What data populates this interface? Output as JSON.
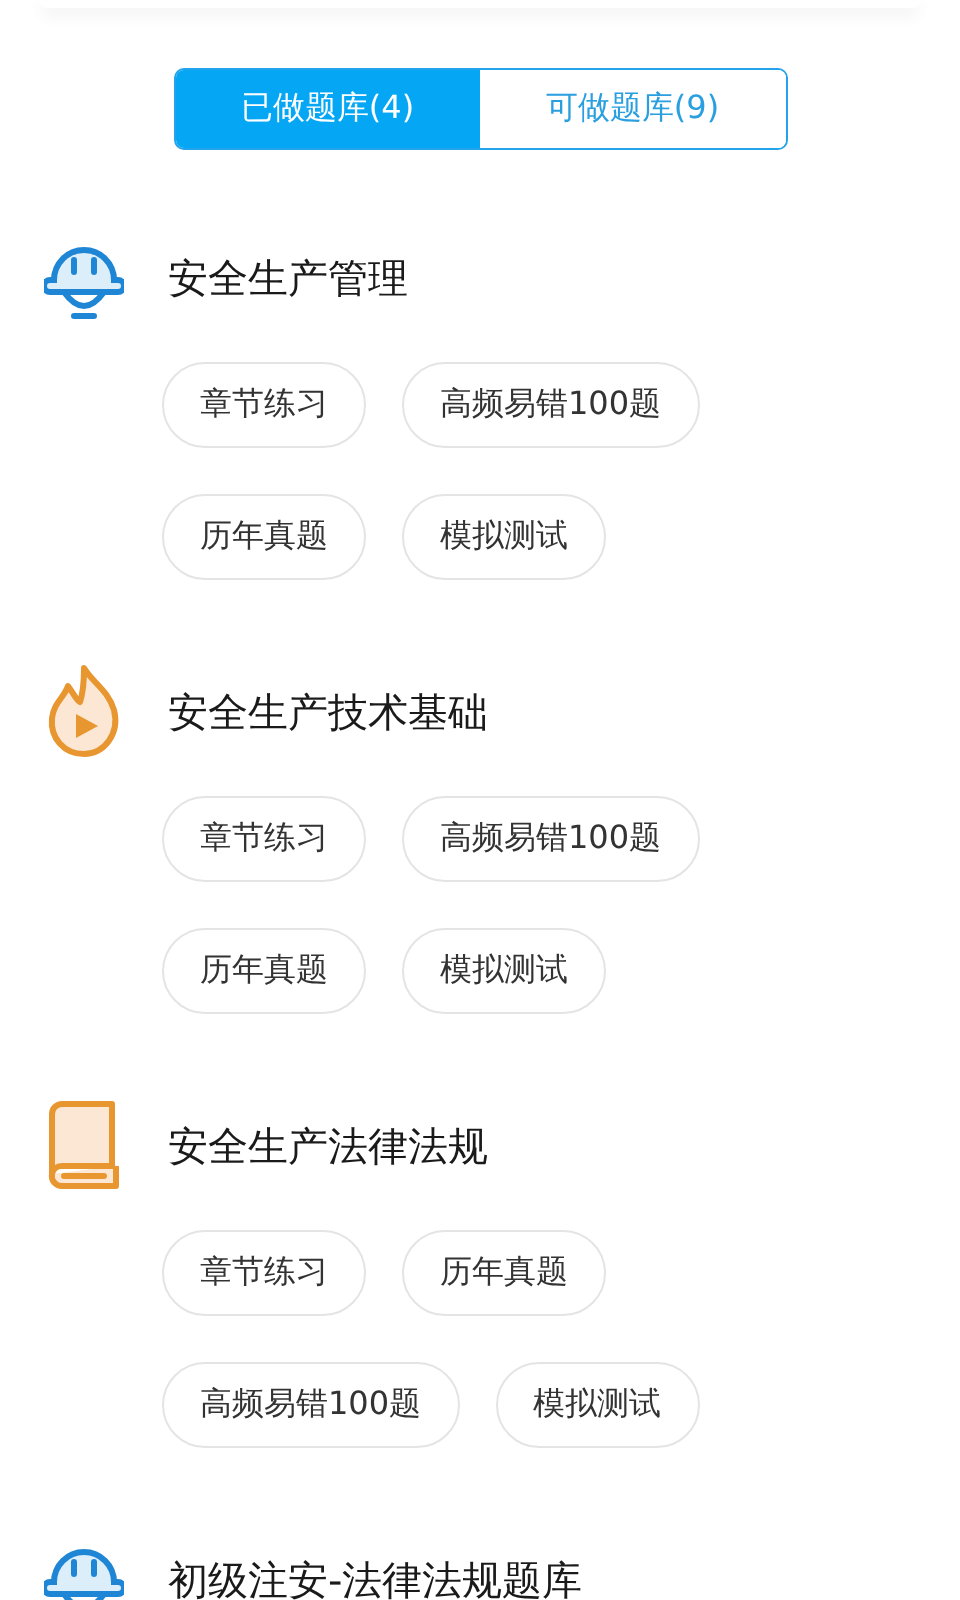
{
  "tabs": [
    {
      "label": "已做题库(4)",
      "selected": true
    },
    {
      "label": "可做题库(9)",
      "selected": false
    }
  ],
  "banks": [
    {
      "kind": "helmet",
      "title": "安全生产管理",
      "chips": [
        "章节练习",
        "高频易错100题",
        "历年真题",
        "模拟测试"
      ]
    },
    {
      "kind": "flame",
      "title": "安全生产技术基础",
      "chips": [
        "章节练习",
        "高频易错100题",
        "历年真题",
        "模拟测试"
      ]
    },
    {
      "kind": "book",
      "title": "安全生产法律法规",
      "chips": [
        "章节练习",
        "历年真题",
        "高频易错100题",
        "模拟测试"
      ]
    },
    {
      "kind": "helmet",
      "title": "初级注安-法律法规题库"
    }
  ]
}
